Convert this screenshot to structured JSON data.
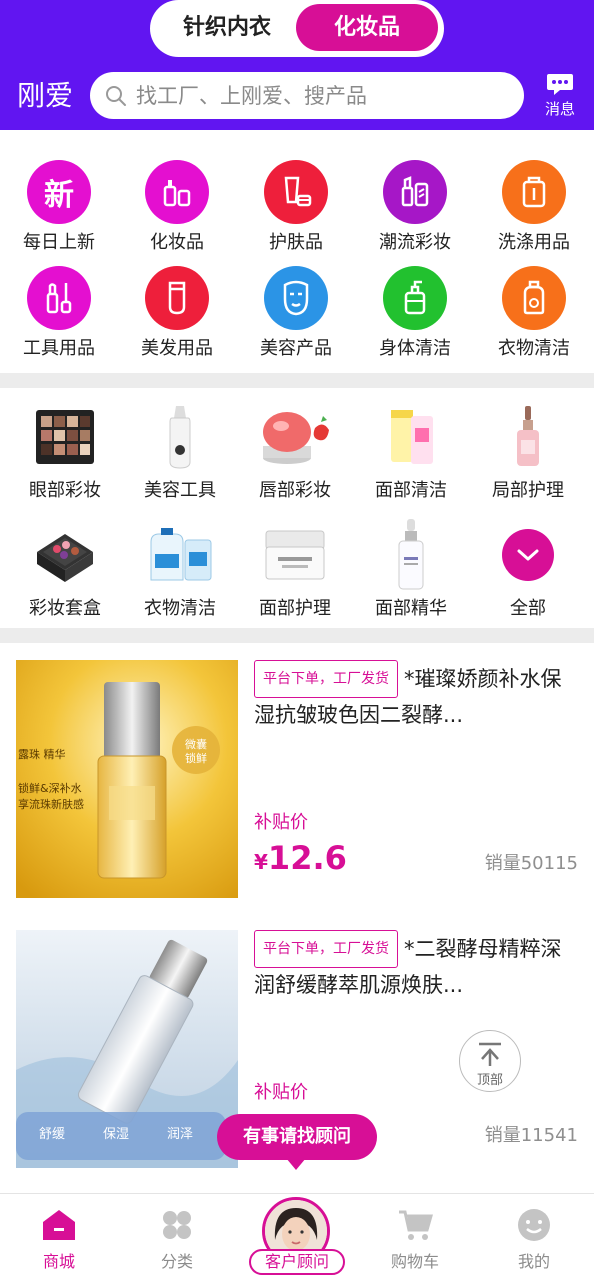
{
  "header": {
    "tabs": [
      {
        "label": "针织内衣"
      },
      {
        "label": "化妆品"
      }
    ],
    "brand": "刚爱",
    "search_placeholder": "找工厂、上刚爱、搜产品",
    "messages_label": "消息"
  },
  "categories": [
    {
      "label": "每日上新",
      "icon": "new-icon",
      "glyph": "新",
      "color": "#e40fd0"
    },
    {
      "label": "化妆品",
      "icon": "cosmetics-icon",
      "color": "#e40fd0"
    },
    {
      "label": "护肤品",
      "icon": "skincare-icon",
      "color": "#ee1f3b"
    },
    {
      "label": "潮流彩妆",
      "icon": "makeup-icon",
      "color": "#a617c7"
    },
    {
      "label": "洗涤用品",
      "icon": "detergent-icon",
      "color": "#f7701a"
    },
    {
      "label": "工具用品",
      "icon": "tools-icon",
      "color": "#e40fd0"
    },
    {
      "label": "美发用品",
      "icon": "haircare-icon",
      "color": "#ee1f3b"
    },
    {
      "label": "美容产品",
      "icon": "face-mask-icon",
      "color": "#2b94e6"
    },
    {
      "label": "身体清洁",
      "icon": "body-wash-icon",
      "color": "#22c12f"
    },
    {
      "label": "衣物清洁",
      "icon": "laundry-icon",
      "color": "#f7701a"
    }
  ],
  "product_categories": [
    {
      "label": "眼部彩妆",
      "icon": "eyeshadow-palette-icon"
    },
    {
      "label": "美容工具",
      "icon": "beauty-device-icon"
    },
    {
      "label": "唇部彩妆",
      "icon": "lip-balm-icon"
    },
    {
      "label": "面部清洁",
      "icon": "face-cleanser-icon"
    },
    {
      "label": "局部护理",
      "icon": "serum-bottle-icon"
    },
    {
      "label": "彩妆套盒",
      "icon": "makeup-kit-icon"
    },
    {
      "label": "衣物清洁",
      "icon": "laundry-detergent-icon"
    },
    {
      "label": "面部护理",
      "icon": "face-cream-icon"
    },
    {
      "label": "面部精华",
      "icon": "essence-bottle-icon"
    },
    {
      "label": "全部",
      "icon": "chevron-down-icon"
    }
  ],
  "products": [
    {
      "tag": "平台下单，工厂发货",
      "title": "*璀璨娇颜补水保湿抗皱玻色因二裂酵...",
      "subsidy_label": "补贴价",
      "currency": "¥",
      "price": "12.6",
      "sales": "销量50115",
      "image_text": [
        "露珠 精华",
        "锁鲜&深补水",
        "享流珠新肤感",
        "微囊",
        "锁鲜"
      ]
    },
    {
      "tag": "平台下单，工厂发货",
      "title": "*二裂酵母精粹深润舒缓酵萃肌源焕肤...",
      "subsidy_label": "补贴价",
      "sales": "销量11541",
      "image_text": [
        "舒缓",
        "保湿",
        "润泽"
      ]
    }
  ],
  "floating": {
    "to_top": "顶部",
    "advisor_bubble": "有事请找顾问"
  },
  "bottom_nav": [
    {
      "label": "商城",
      "icon": "home-icon",
      "active": true
    },
    {
      "label": "分类",
      "icon": "category-icon"
    },
    {
      "label": "客户顾问",
      "icon": "advisor-avatar"
    },
    {
      "label": "购物车",
      "icon": "cart-icon"
    },
    {
      "label": "我的",
      "icon": "profile-icon"
    }
  ],
  "colors": {
    "header": "#6115f1",
    "accent": "#d70f96"
  }
}
